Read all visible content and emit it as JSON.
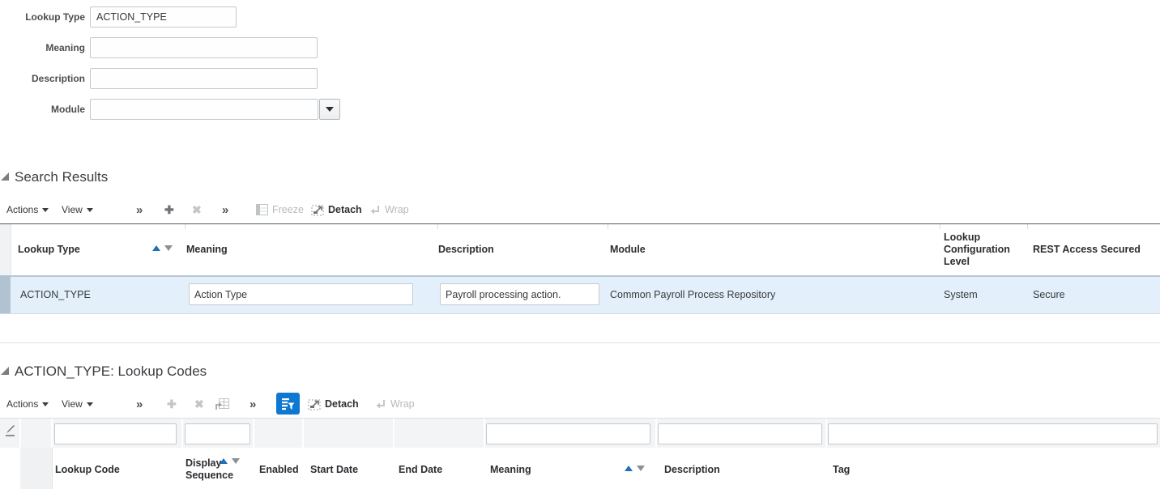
{
  "form": {
    "fields": {
      "lookup_type": {
        "label": "Lookup Type",
        "value": "ACTION_TYPE"
      },
      "meaning": {
        "label": "Meaning",
        "value": ""
      },
      "description": {
        "label": "Description",
        "value": ""
      },
      "module": {
        "label": "Module",
        "value": ""
      }
    }
  },
  "search_results": {
    "title": "Search Results",
    "toolbar": {
      "actions": "Actions",
      "view": "View",
      "freeze": "Freeze",
      "detach": "Detach",
      "wrap": "Wrap"
    },
    "columns": [
      "Lookup Type",
      "Meaning",
      "Description",
      "Module",
      "Lookup Configuration Level",
      "REST Access Secured"
    ],
    "row": {
      "lookup_type": "ACTION_TYPE",
      "meaning": "Action Type",
      "description": "Payroll processing action.",
      "module": "Common Payroll Process Repository",
      "lookup_configuration_level": "System",
      "rest_access_secured": "Secure"
    }
  },
  "lookup_codes": {
    "title": "ACTION_TYPE: Lookup Codes",
    "toolbar": {
      "actions": "Actions",
      "view": "View",
      "detach": "Detach",
      "wrap": "Wrap"
    },
    "columns": [
      "Lookup Code",
      "Display Sequence",
      "Enabled",
      "Start Date",
      "End Date",
      "Meaning",
      "Description",
      "Tag"
    ]
  },
  "colors": {
    "accent_blue": "#0c78d2",
    "sort_active_blue": "#1f70b6",
    "selected_row_bg": "#e3f0fb",
    "row_selector_bar": "#b1c3d2"
  }
}
